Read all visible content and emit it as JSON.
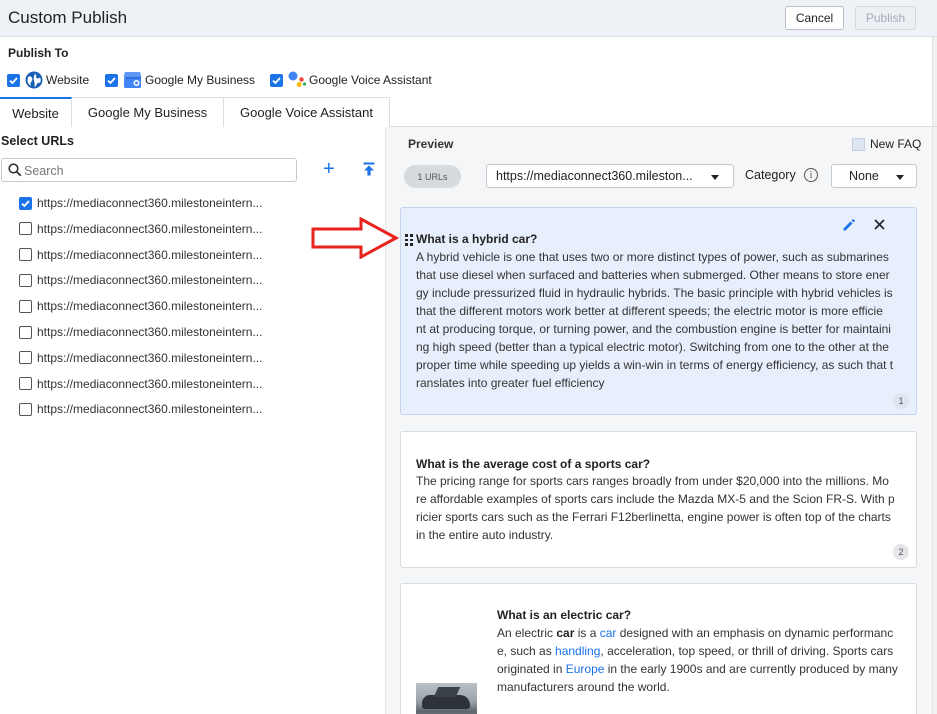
{
  "header": {
    "title": "Custom Publish",
    "cancel_label": "Cancel",
    "publish_label": "Publish"
  },
  "publish_to": {
    "label": "Publish To",
    "targets": [
      {
        "label": "Website",
        "checked": true
      },
      {
        "label": "Google My Business",
        "checked": true
      },
      {
        "label": "Google Voice Assistant",
        "checked": true
      }
    ]
  },
  "tabs": [
    {
      "label": "Website",
      "active": true
    },
    {
      "label": "Google My Business",
      "active": false
    },
    {
      "label": "Google Voice Assistant",
      "active": false
    }
  ],
  "left_panel": {
    "title": "Select URLs",
    "search_placeholder": "Search",
    "urls": [
      {
        "text": "https://mediaconnect360.milestoneintern...",
        "checked": true
      },
      {
        "text": "https://mediaconnect360.milestoneintern...",
        "checked": false
      },
      {
        "text": "https://mediaconnect360.milestoneintern...",
        "checked": false
      },
      {
        "text": "https://mediaconnect360.milestoneintern...",
        "checked": false
      },
      {
        "text": "https://mediaconnect360.milestoneintern...",
        "checked": false
      },
      {
        "text": "https://mediaconnect360.milestoneintern...",
        "checked": false
      },
      {
        "text": "https://mediaconnect360.milestoneintern...",
        "checked": false
      },
      {
        "text": "https://mediaconnect360.milestoneintern...",
        "checked": false
      },
      {
        "text": "https://mediaconnect360.milestoneintern...",
        "checked": false
      }
    ]
  },
  "preview": {
    "title": "Preview",
    "new_faq_label": "New FAQ",
    "url_count": "1 URLs",
    "url_select": "https://mediaconnect360.mileston...",
    "category_label": "Category",
    "category_value": "None",
    "faqs": [
      {
        "question": "What is a hybrid car?",
        "answer_lines": [
          "A hybrid vehicle is one that uses two or more distinct types of power, such as submarines",
          "that use diesel when surfaced and batteries when submerged. Other means to store ener",
          "gy include pressurized fluid in hydraulic hybrids. The basic principle with hybrid vehicles is",
          "that the different motors work better at different speeds; the electric motor is more efficie",
          "nt at producing torque, or turning power, and the combustion engine is better for maintaini",
          "ng high speed (better than a typical electric motor). Switching from one to the other at the",
          "proper time while speeding up yields a win-win in terms of energy efficiency, as such that t",
          "ranslates into greater fuel efficiency"
        ],
        "number": "1"
      },
      {
        "question": "What is the average cost of a sports car?",
        "answer_lines": [
          "The pricing range for sports cars ranges broadly from under $20,000 into the millions. Mo",
          "re affordable examples of sports cars include the Mazda MX-5 and the Scion FR-S. With p",
          "ricier sports cars such as the Ferrari F12berlinetta, engine power is often top of the charts",
          "in the entire auto industry."
        ],
        "number": "2"
      },
      {
        "question": "What is an electric car?",
        "answer_parts": {
          "l1_a": "An electric ",
          "l1_b": "car",
          "l1_c": " is a ",
          "l1_d": "car",
          "l1_e": " designed with an emphasis on dynamic performanc",
          "l2_a": "e, such as ",
          "l2_b": "handling",
          "l2_c": ", acceleration, top speed, or thrill of driving. Sports cars",
          "l3_a": "originated in ",
          "l3_b": "Europe",
          "l3_c": " in the early 1900s and are currently produced by many",
          "l4": "manufacturers around the world."
        }
      }
    ]
  },
  "colors": {
    "accent": "#1a73e8",
    "selected_card": "#e8effc",
    "annotation_arrow": "#e8231e"
  }
}
